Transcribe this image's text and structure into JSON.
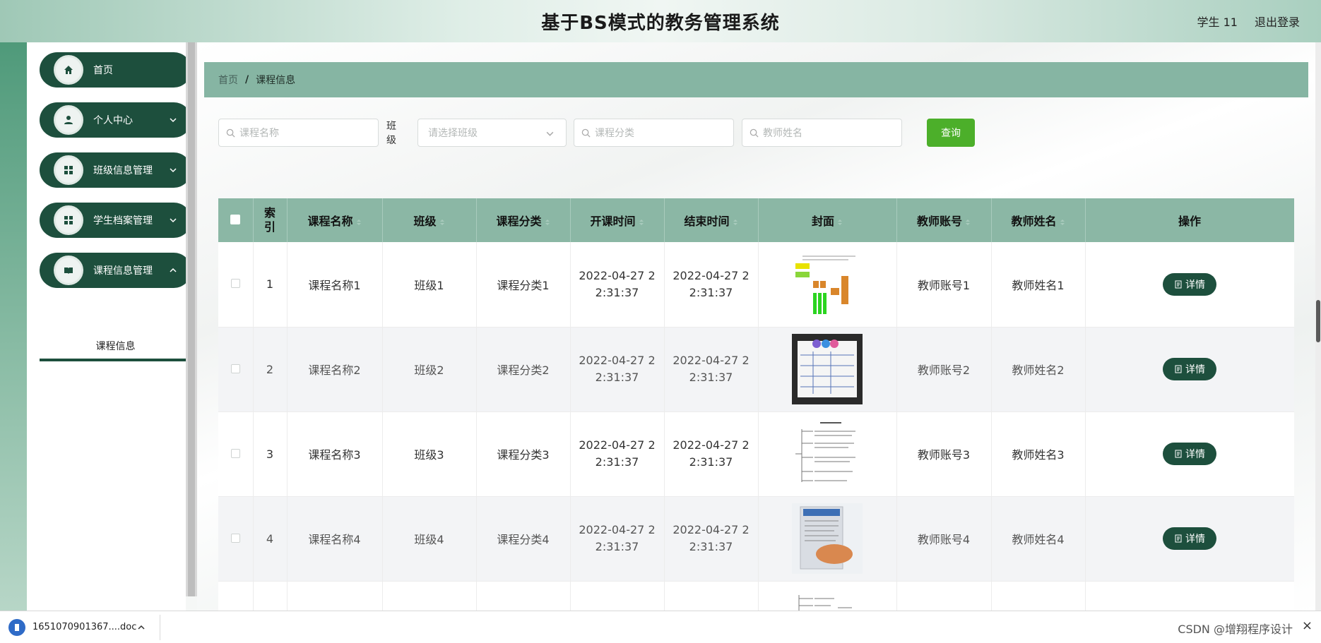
{
  "header": {
    "title": "基于BS模式的教务管理系统",
    "user": "学生 11",
    "logout": "退出登录"
  },
  "sidebar": {
    "items": [
      {
        "label": "首页",
        "icon": "home-icon"
      },
      {
        "label": "个人中心",
        "icon": "user-icon"
      },
      {
        "label": "班级信息管理",
        "icon": "grid-icon"
      },
      {
        "label": "学生档案管理",
        "icon": "grid-icon"
      },
      {
        "label": "课程信息管理",
        "icon": "book-icon"
      }
    ],
    "sub_active": "课程信息"
  },
  "breadcrumb": {
    "home": "首页",
    "sep": "/",
    "current": "课程信息"
  },
  "search": {
    "course_name_ph": "课程名称",
    "class_label": "班级",
    "class_ph": "请选择班级",
    "category_ph": "课程分类",
    "teacher_ph": "教师姓名",
    "query": "查询"
  },
  "table": {
    "headers": [
      "索引",
      "课程名称",
      "班级",
      "课程分类",
      "开课时间",
      "结束时间",
      "封面",
      "教师账号",
      "教师姓名",
      "操作"
    ],
    "rows": [
      {
        "idx": "1",
        "name": "课程名称1",
        "class": "班级1",
        "cat": "课程分类1",
        "start_a": "2022-04-27 2",
        "start_b": "2:31:37",
        "end_a": "2022-04-27 2",
        "end_b": "2:31:37",
        "acct": "教师账号1",
        "teacher": "教师姓名1",
        "action": "详情"
      },
      {
        "idx": "2",
        "name": "课程名称2",
        "class": "班级2",
        "cat": "课程分类2",
        "start_a": "2022-04-27 2",
        "start_b": "2:31:37",
        "end_a": "2022-04-27 2",
        "end_b": "2:31:37",
        "acct": "教师账号2",
        "teacher": "教师姓名2",
        "action": "详情"
      },
      {
        "idx": "3",
        "name": "课程名称3",
        "class": "班级3",
        "cat": "课程分类3",
        "start_a": "2022-04-27 2",
        "start_b": "2:31:37",
        "end_a": "2022-04-27 2",
        "end_b": "2:31:37",
        "acct": "教师账号3",
        "teacher": "教师姓名3",
        "action": "详情"
      },
      {
        "idx": "4",
        "name": "课程名称4",
        "class": "班级4",
        "cat": "课程分类4",
        "start_a": "2022-04-27 2",
        "start_b": "2:31:37",
        "end_a": "2022-04-27 2",
        "end_b": "2:31:37",
        "acct": "教师账号4",
        "teacher": "教师姓名4",
        "action": "详情"
      }
    ]
  },
  "download": {
    "filename": "1651070901367....doc"
  },
  "watermark": "CSDN @增翔程序设计",
  "colors": {
    "accent": "#1d4f3d",
    "header_row": "#8bb7a5",
    "query_btn": "#4caf2a"
  }
}
